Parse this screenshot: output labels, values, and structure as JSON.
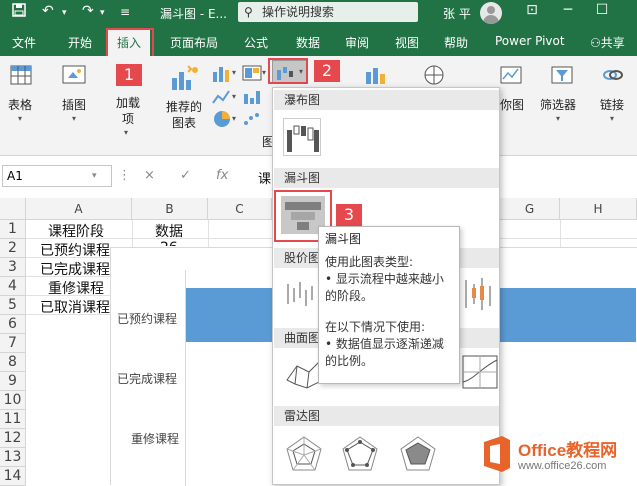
{
  "titlebar": {
    "doc_title": "漏斗图 - E...",
    "search_placeholder": "操作说明搜索",
    "user_name": "张 平"
  },
  "tabs": [
    "文件",
    "开始",
    "插入",
    "页面布局",
    "公式",
    "数据",
    "审阅",
    "视图",
    "帮助",
    "Power Pivot"
  ],
  "active_tab": "插入",
  "share_label": "共享",
  "ribbon": {
    "table_label": "表格",
    "illustration_label": "插图",
    "addin_label_1": "加载",
    "addin_label_2": "项",
    "recommended_label_1": "推荐的",
    "recommended_label_2": "图表",
    "chart_group_initial": "图",
    "map_label": "你图",
    "filter_label": "筛选器",
    "link_label": "链接"
  },
  "callouts": [
    "1",
    "2",
    "3"
  ],
  "formula_bar": {
    "name_box": "A1",
    "cancel_icon": "×",
    "enter_icon": "✓",
    "fx_label": "fx",
    "content": "课"
  },
  "columns": [
    "A",
    "B",
    "C",
    "G",
    "H"
  ],
  "rows": [
    "1",
    "2",
    "3",
    "4",
    "5",
    "6",
    "7",
    "8",
    "9",
    "10",
    "11",
    "12",
    "13",
    "14"
  ],
  "table": {
    "header": [
      "课程阶段",
      "数据"
    ],
    "labels": [
      "已预约课程",
      "已完成课程",
      "重修课程",
      "已取消课程"
    ],
    "b2_partial": "26"
  },
  "chart": {
    "y_categories": [
      "已预约课程",
      "已完成课程",
      "重修课程"
    ]
  },
  "dropdown": {
    "sections": [
      "瀑布图",
      "漏斗图",
      "股价图",
      "曲面图",
      "雷达图"
    ]
  },
  "tooltip": {
    "title": "漏斗图",
    "line1": "使用此图表类型:",
    "line2": "• 显示流程中越来越小的阶段。",
    "line3": "在以下情况下使用:",
    "line4": "• 数据值显示逐渐递减的比例。"
  },
  "watermark": {
    "brand": "Office教程网",
    "url": "www.office26.com"
  },
  "colors": {
    "excel_green": "#217346",
    "callout_red": "#e5484d",
    "bar_blue": "#5b9bd5",
    "watermark_orange": "#e8642a"
  }
}
